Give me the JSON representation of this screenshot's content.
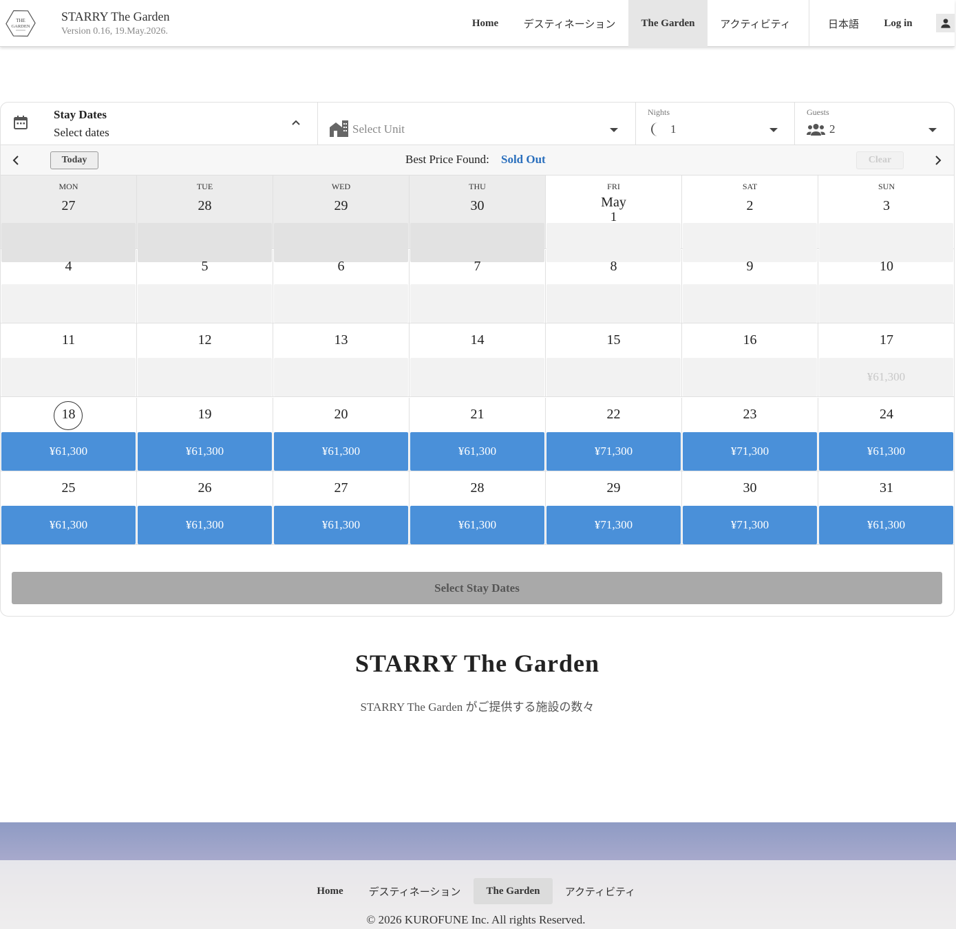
{
  "header": {
    "logo_text": "THE GARDEN",
    "brand_title": "STARRY The Garden",
    "version": "Version 0.16, 19.May.2026.",
    "nav": [
      {
        "label": "Home"
      },
      {
        "label": "デスティネーション"
      },
      {
        "label": "The Garden",
        "active": true
      },
      {
        "label": "アクティビティ"
      }
    ],
    "language": "日本語",
    "login": "Log in",
    "user_icon": "person-icon"
  },
  "booking": {
    "stay_dates_label": "Stay Dates",
    "stay_dates_value": "Select dates",
    "unit_placeholder": "Select Unit",
    "nights_label": "Nights",
    "nights_value": "1",
    "guests_label": "Guests",
    "guests_value": "2",
    "today_btn": "Today",
    "best_price_label": "Best Price Found:",
    "best_price_value": "Sold Out",
    "clear_btn": "Clear",
    "select_btn": "Select Stay Dates",
    "accent_color": "#4a90d9"
  },
  "calendar": {
    "weekdays": [
      "MON",
      "TUE",
      "WED",
      "THU",
      "FRI",
      "SAT",
      "SUN"
    ],
    "may_label": "May",
    "weeks": [
      [
        {
          "day": "27",
          "state": "past",
          "price": ""
        },
        {
          "day": "28",
          "state": "past",
          "price": ""
        },
        {
          "day": "29",
          "state": "past",
          "price": ""
        },
        {
          "day": "30",
          "state": "past",
          "price": ""
        },
        {
          "day": "1",
          "state": "unavailable",
          "price": "",
          "month": "May"
        },
        {
          "day": "2",
          "state": "unavailable",
          "price": ""
        },
        {
          "day": "3",
          "state": "unavailable",
          "price": ""
        }
      ],
      [
        {
          "day": "4",
          "state": "unavailable",
          "price": ""
        },
        {
          "day": "5",
          "state": "unavailable",
          "price": ""
        },
        {
          "day": "6",
          "state": "unavailable",
          "price": ""
        },
        {
          "day": "7",
          "state": "unavailable",
          "price": ""
        },
        {
          "day": "8",
          "state": "unavailable",
          "price": ""
        },
        {
          "day": "9",
          "state": "unavailable",
          "price": ""
        },
        {
          "day": "10",
          "state": "unavailable",
          "price": ""
        }
      ],
      [
        {
          "day": "11",
          "state": "unavailable",
          "price": ""
        },
        {
          "day": "12",
          "state": "unavailable",
          "price": ""
        },
        {
          "day": "13",
          "state": "unavailable",
          "price": ""
        },
        {
          "day": "14",
          "state": "unavailable",
          "price": ""
        },
        {
          "day": "15",
          "state": "unavailable",
          "price": ""
        },
        {
          "day": "16",
          "state": "unavailable",
          "price": ""
        },
        {
          "day": "17",
          "state": "unavailable",
          "price": "¥61,300"
        }
      ],
      [
        {
          "day": "18",
          "state": "available",
          "price": "¥61,300",
          "today": true
        },
        {
          "day": "19",
          "state": "available",
          "price": "¥61,300"
        },
        {
          "day": "20",
          "state": "available",
          "price": "¥61,300"
        },
        {
          "day": "21",
          "state": "available",
          "price": "¥61,300"
        },
        {
          "day": "22",
          "state": "available",
          "price": "¥71,300"
        },
        {
          "day": "23",
          "state": "available",
          "price": "¥71,300"
        },
        {
          "day": "24",
          "state": "available",
          "price": "¥61,300"
        }
      ],
      [
        {
          "day": "25",
          "state": "available",
          "price": "¥61,300"
        },
        {
          "day": "26",
          "state": "available",
          "price": "¥61,300"
        },
        {
          "day": "27",
          "state": "available",
          "price": "¥61,300"
        },
        {
          "day": "28",
          "state": "available",
          "price": "¥61,300"
        },
        {
          "day": "29",
          "state": "available",
          "price": "¥71,300"
        },
        {
          "day": "30",
          "state": "available",
          "price": "¥71,300"
        },
        {
          "day": "31",
          "state": "available",
          "price": "¥61,300"
        }
      ]
    ]
  },
  "section": {
    "title": "STARRY The Garden",
    "subtitle": "STARRY The Garden がご提供する施設の数々"
  },
  "footer": {
    "nav": [
      {
        "label": "Home"
      },
      {
        "label": "デスティネーション"
      },
      {
        "label": "The Garden",
        "active": true
      },
      {
        "label": "アクティビティ"
      }
    ],
    "copyright": "© 2026 KUROFUNE Inc. All rights Reserved."
  }
}
